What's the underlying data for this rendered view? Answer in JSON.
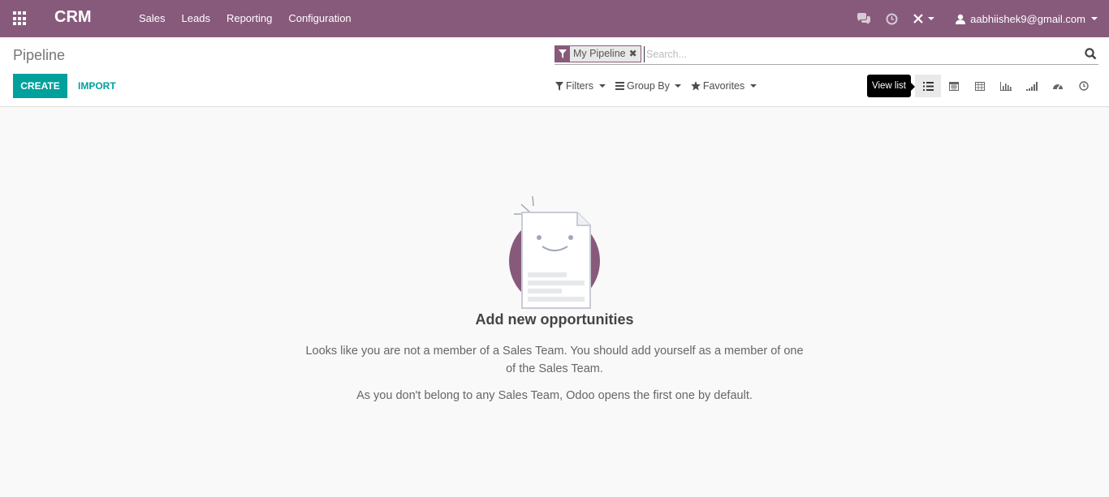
{
  "navbar": {
    "apps_icon": "apps-grid-icon",
    "brand": "CRM",
    "menu": [
      "Sales",
      "Leads",
      "Reporting",
      "Configuration"
    ],
    "user": "aabhiishek9@gmail.com",
    "color": "#875a7b"
  },
  "control_panel": {
    "title": "Pipeline",
    "create_label": "CREATE",
    "import_label": "IMPORT",
    "search": {
      "facet_label": "My Pipeline",
      "facet_remove": "✖",
      "placeholder": "Search..."
    },
    "filters": [
      "Filters",
      "Group By",
      "Favorites"
    ],
    "views": [
      "list",
      "calendar",
      "pivot",
      "graph",
      "cohort",
      "dashboard",
      "activity"
    ],
    "active_view": "list",
    "tooltip": "View list"
  },
  "help": {
    "title": "Add new opportunities",
    "p1": "Looks like you are not a member of a Sales Team. You should add yourself as a member of one of the Sales Team.",
    "p2": "As you don't belong to any Sales Team, Odoo opens the first one by default."
  },
  "colors": {
    "primary": "#00a09d",
    "brand": "#875a7b"
  }
}
